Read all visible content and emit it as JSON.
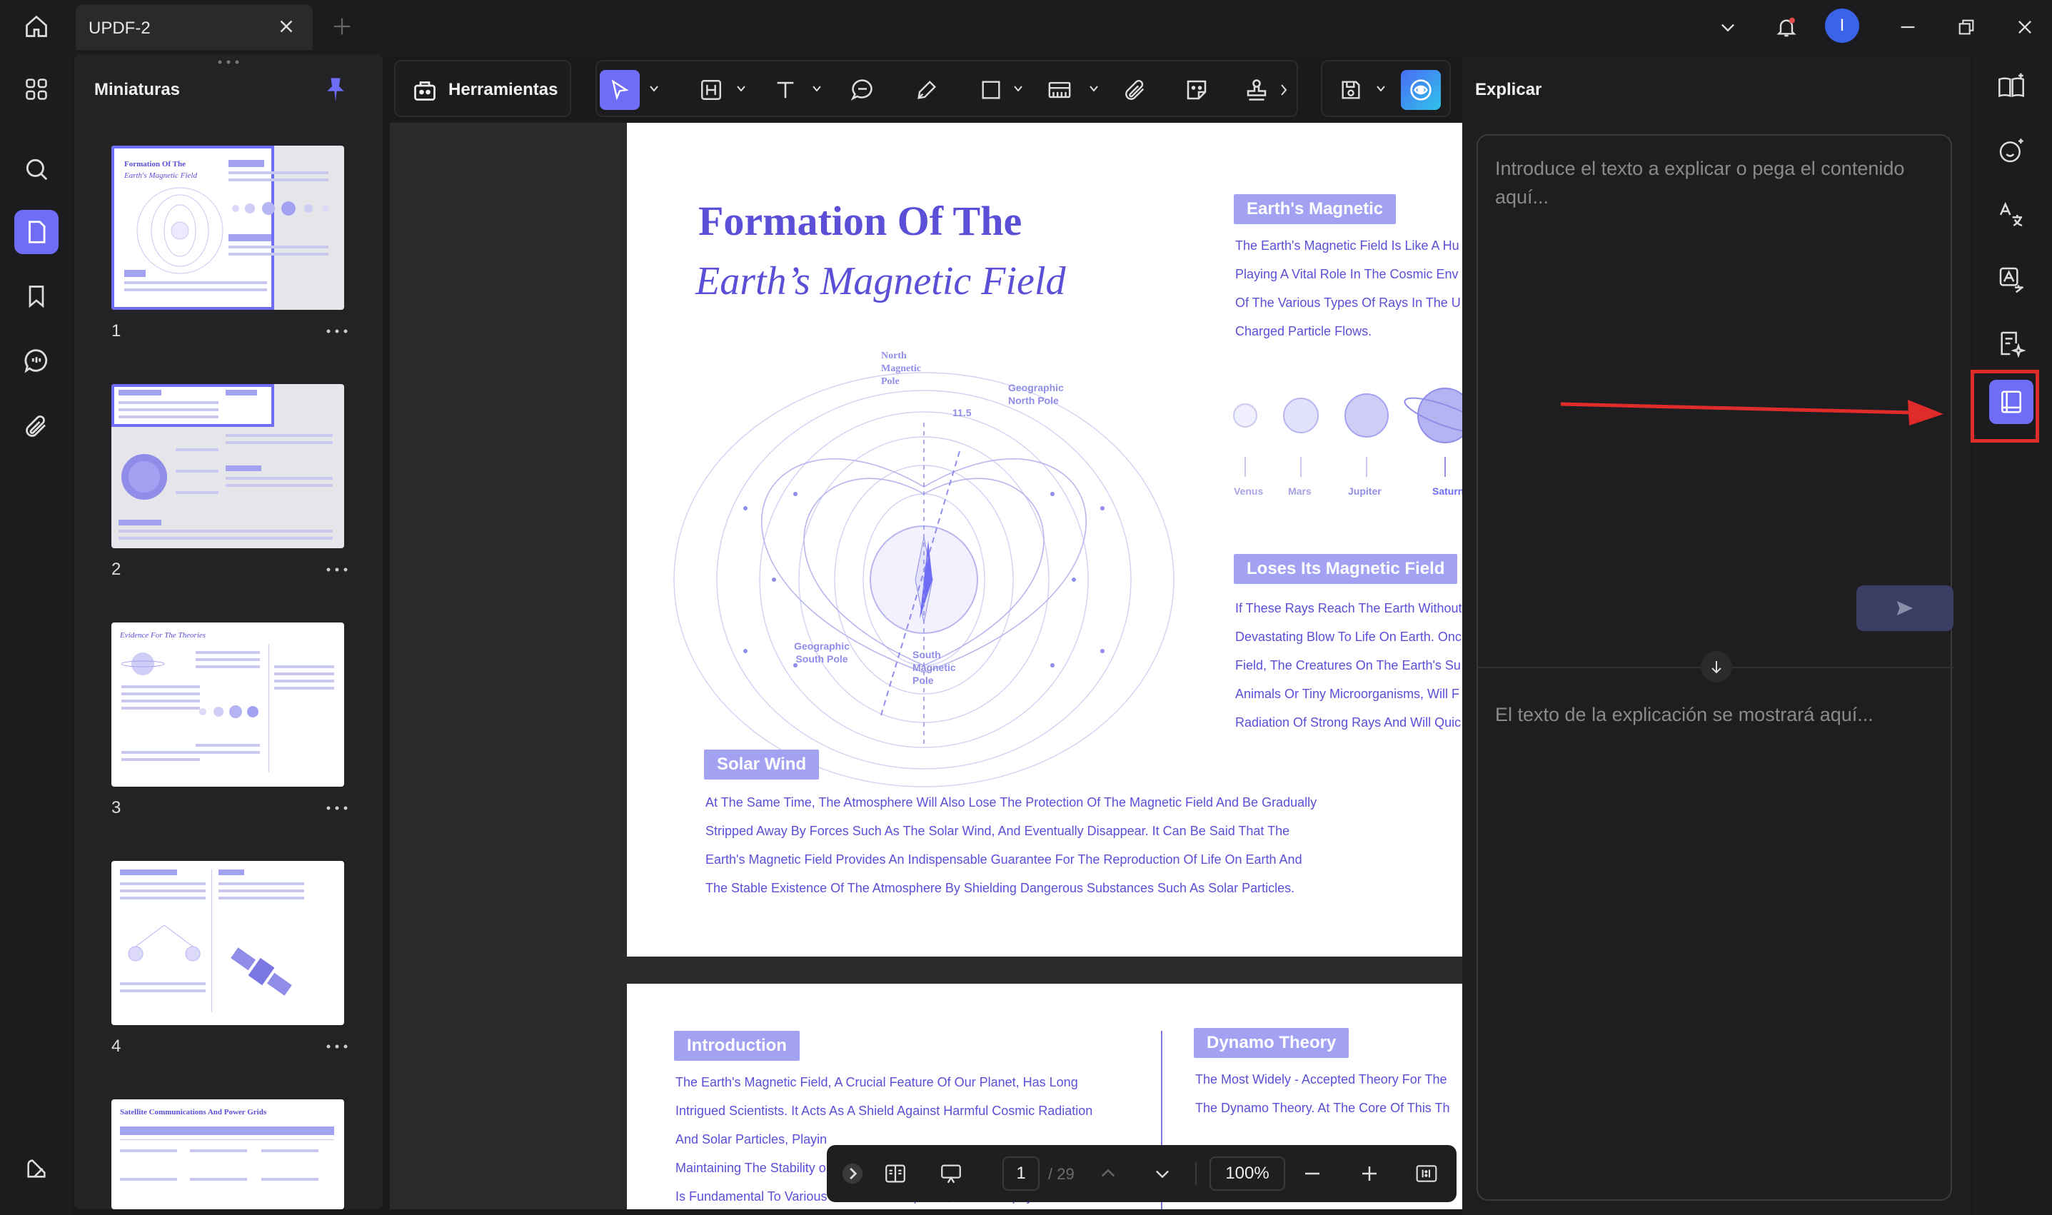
{
  "titlebar": {
    "tab_title": "UPDF-2",
    "avatar_initial": "I"
  },
  "thumbnails": {
    "title": "Miniaturas",
    "pages": [
      {
        "num": "1",
        "heading": "Formation Of The",
        "heading2": "Earth's Magnetic Field"
      },
      {
        "num": "2"
      },
      {
        "num": "3",
        "heading": "Evidence For The Theories"
      },
      {
        "num": "4"
      },
      {
        "num": "",
        "heading": "Satellite Communications And Power Grids"
      }
    ]
  },
  "toolbar": {
    "tools_label": "Herramientas"
  },
  "document": {
    "page1": {
      "title_line1": "Formation Of The",
      "title_line2": "Earth’s Magnetic Field",
      "diagram_labels": {
        "north_magnetic": "North Magnetic Pole",
        "geo_north": "Geographic North Pole",
        "geo_south": "Geographic South Pole",
        "south_magnetic": "South Magnetic Pole",
        "angle": "11.5"
      },
      "earth_tag": "Earth's Magnetic",
      "earth_text": [
        "The Earth's Magnetic Field Is Like A Hu",
        "Playing A Vital Role In The Cosmic Env",
        "Of The Various Types Of Rays In The U",
        "Charged Particle Flows."
      ],
      "planets": [
        "Venus",
        "Mars",
        "Jupiter",
        "Saturn"
      ],
      "loses_tag": "Loses Its Magnetic Field",
      "loses_text": [
        "If These Rays Reach The Earth Without",
        "Devastating Blow To Life On Earth. Onc",
        "Field, The Creatures On The Earth's Su",
        "Animals Or Tiny Microorganisms, Will F",
        "Radiation Of Strong Rays And Will Quic"
      ],
      "solar_tag": "Solar Wind",
      "solar_text": [
        "At The Same Time, The Atmosphere Will Also Lose The Protection Of The Magnetic Field And Be Gradually",
        "Stripped Away By Forces Such As The Solar Wind, And Eventually Disappear. It Can Be Said That The",
        "Earth's Magnetic Field Provides An Indispensable Guarantee For The Reproduction Of Life On Earth And",
        "The Stable Existence Of The Atmosphere By Shielding Dangerous Substances Such As Solar Particles."
      ]
    },
    "page2": {
      "intro_tag": "Introduction",
      "intro_text": [
        "The Earth's Magnetic Field, A Crucial Feature Of Our Planet, Has Long",
        "Intrigued Scientists. It Acts As A Shield Against Harmful Cosmic Radiation",
        "And Solar Particles, Playin",
        "Maintaining The Stability o",
        "Is Fundamental To Various Scientific Disciplines, From Geophysics To"
      ],
      "dynamo_tag": "Dynamo Theory",
      "dynamo_text": [
        "The Most Widely - Accepted Theory For The",
        "The Dynamo Theory. At The Core Of This Th",
        "",
        "",
        "Convection Currents Within The Fluid"
      ]
    }
  },
  "bottombar": {
    "page_current": "1",
    "page_total": "/ 29",
    "zoom": "100%"
  },
  "explain": {
    "title": "Explicar",
    "input_placeholder": "Introduce el texto a explicar o pega el contenido aquí...",
    "output_placeholder": "El texto de la explicación se mostrará aquí..."
  },
  "colors": {
    "accent": "#6f6cf6",
    "doc_purple": "#5a4fd6",
    "tag_bg": "#a3a2f2",
    "highlight_red": "#e02b2b"
  }
}
